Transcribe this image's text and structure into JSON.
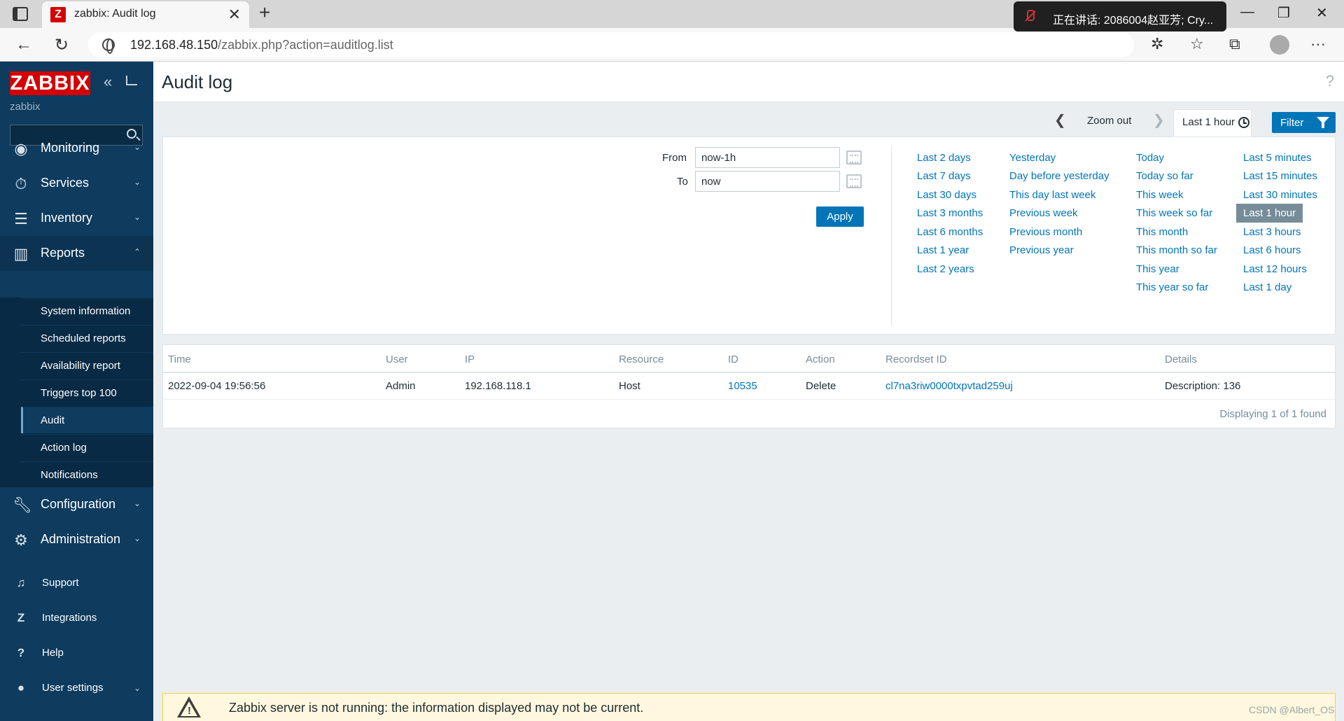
{
  "browser": {
    "tab_title": "zabbix: Audit log",
    "tab_favicon": "Z",
    "tab_close": "✕",
    "new_tab": "+",
    "url_host": "192.168.48.150",
    "url_path": "/zabbix.php?action=auditlog.list",
    "notification": "正在讲话: 2086004赵亚芳; Cry...",
    "minimize": "—",
    "maximize": "❐",
    "close": "✕",
    "back": "←",
    "reload": "↻",
    "more": "···"
  },
  "sidebar": {
    "logo": "ZABBIX",
    "username": "zabbix",
    "search_value": "",
    "collapse_icon": "«",
    "menu": [
      {
        "label": "Monitoring",
        "icon": "eye-icon"
      },
      {
        "label": "Services",
        "icon": "stopwatch-icon"
      },
      {
        "label": "Inventory",
        "icon": "list-icon"
      },
      {
        "label": "Reports",
        "icon": "bar-chart-icon"
      }
    ],
    "reports_submenu": [
      {
        "label": "System information"
      },
      {
        "label": "Scheduled reports"
      },
      {
        "label": "Availability report"
      },
      {
        "label": "Triggers top 100"
      },
      {
        "label": "Audit"
      },
      {
        "label": "Action log"
      },
      {
        "label": "Notifications"
      }
    ],
    "menu_lower": [
      {
        "label": "Configuration",
        "icon": "wrench-icon"
      },
      {
        "label": "Administration",
        "icon": "gear-icon"
      }
    ],
    "bottom": [
      {
        "label": "Support"
      },
      {
        "label": "Integrations"
      },
      {
        "label": "Help"
      },
      {
        "label": "User settings"
      }
    ]
  },
  "header": {
    "title": "Audit log",
    "help": "?"
  },
  "timebar": {
    "zoom_out": "Zoom out",
    "range_label": "Last 1 hour",
    "filter_label": "Filter"
  },
  "filter": {
    "from_label": "From",
    "from_value": "now-1h",
    "to_label": "To",
    "to_value": "now",
    "apply_label": "Apply",
    "quick_ranges": [
      [
        "Last 2 days",
        "Last 7 days",
        "Last 30 days",
        "Last 3 months",
        "Last 6 months",
        "Last 1 year",
        "Last 2 years"
      ],
      [
        "Yesterday",
        "Day before yesterday",
        "This day last week",
        "Previous week",
        "Previous month",
        "Previous year"
      ],
      [
        "Today",
        "Today so far",
        "This week",
        "This week so far",
        "This month",
        "This month so far",
        "This year",
        "This year so far"
      ],
      [
        "Last 5 minutes",
        "Last 15 minutes",
        "Last 30 minutes",
        "Last 1 hour",
        "Last 3 hours",
        "Last 6 hours",
        "Last 12 hours",
        "Last 1 day"
      ]
    ],
    "selected_range": "Last 1 hour"
  },
  "table": {
    "columns": [
      "Time",
      "User",
      "IP",
      "Resource",
      "ID",
      "Action",
      "Recordset ID",
      "Details"
    ],
    "rows": [
      [
        "2022-09-04 19:56:56",
        "Admin",
        "192.168.118.1",
        "Host",
        "10535",
        "Delete",
        "cl7na3riw0000txpvtad259uj",
        "Description: 136"
      ]
    ],
    "stats": "Displaying 1 of 1 found"
  },
  "warning": {
    "message": "Zabbix server is not running: the information displayed may not be current."
  },
  "watermark": "CSDN @Albert_OS"
}
